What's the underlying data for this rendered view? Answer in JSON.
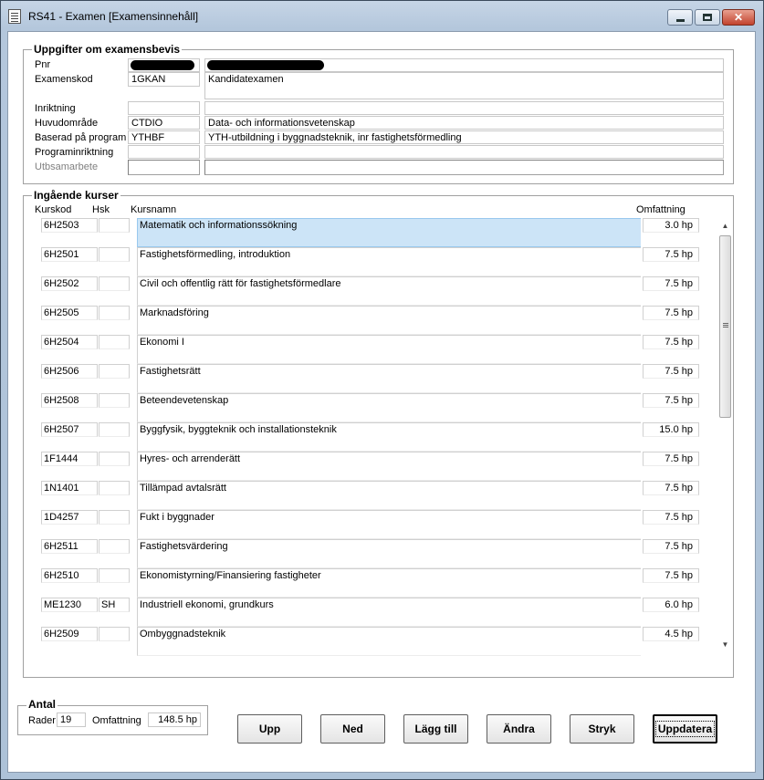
{
  "window": {
    "title": "RS41 - Examen [Examensinnehåll]",
    "close_glyph": "✕"
  },
  "examensbevis": {
    "legend": "Uppgifter om examensbevis",
    "pnr_label": "Pnr",
    "examenskod_label": "Examenskod",
    "examenskod_value": "1GKAN",
    "examen_name": "Kandidatexamen",
    "inriktning_label": "Inriktning",
    "huvudomrade_label": "Huvudområde",
    "huvudomrade_code": "CTDIO",
    "huvudomrade_name": "Data- och informationsvetenskap",
    "program_label": "Baserad på program",
    "program_code": "YTHBF",
    "program_name": "YTH-utbildning i byggnadsteknik, inr fastighetsförmedling",
    "programinriktning_label": "Programinriktning",
    "utbsamarbete_label": "Utbsamarbete"
  },
  "kurser": {
    "legend": "Ingående kurser",
    "headers": {
      "kod": "Kurskod",
      "hsk": "Hsk",
      "namn": "Kursnamn",
      "omf": "Omfattning"
    },
    "rows": [
      {
        "kod": "6H2503",
        "hsk": "",
        "namn": "Matematik och informationssökning",
        "omf": "3.0 hp"
      },
      {
        "kod": "6H2501",
        "hsk": "",
        "namn": "Fastighetsförmedling, introduktion",
        "omf": "7.5 hp"
      },
      {
        "kod": "6H2502",
        "hsk": "",
        "namn": "Civil och offentlig rätt för fastighetsförmedlare",
        "omf": "7.5 hp"
      },
      {
        "kod": "6H2505",
        "hsk": "",
        "namn": "Marknadsföring",
        "omf": "7.5 hp"
      },
      {
        "kod": "6H2504",
        "hsk": "",
        "namn": "Ekonomi I",
        "omf": "7.5 hp"
      },
      {
        "kod": "6H2506",
        "hsk": "",
        "namn": "Fastighetsrätt",
        "omf": "7.5 hp"
      },
      {
        "kod": "6H2508",
        "hsk": "",
        "namn": "Beteendevetenskap",
        "omf": "7.5 hp"
      },
      {
        "kod": "6H2507",
        "hsk": "",
        "namn": "Byggfysik, byggteknik och installationsteknik",
        "omf": "15.0 hp"
      },
      {
        "kod": "1F1444",
        "hsk": "",
        "namn": "Hyres- och arrenderätt",
        "omf": "7.5 hp"
      },
      {
        "kod": "1N1401",
        "hsk": "",
        "namn": "Tillämpad avtalsrätt",
        "omf": "7.5 hp"
      },
      {
        "kod": "1D4257",
        "hsk": "",
        "namn": "Fukt i byggnader",
        "omf": "7.5 hp"
      },
      {
        "kod": "6H2511",
        "hsk": "",
        "namn": "Fastighetsvärdering",
        "omf": "7.5 hp"
      },
      {
        "kod": "6H2510",
        "hsk": "",
        "namn": "Ekonomistyrning/Finansiering fastigheter",
        "omf": "7.5 hp"
      },
      {
        "kod": "ME1230",
        "hsk": "SH",
        "namn": "Industriell ekonomi, grundkurs",
        "omf": "6.0 hp"
      },
      {
        "kod": "6H2509",
        "hsk": "",
        "namn": "Ombyggnadsteknik",
        "omf": "4.5 hp"
      }
    ],
    "scroll_up": "▲",
    "scroll_down": "▼"
  },
  "antal": {
    "legend": "Antal",
    "rader_label": "Rader",
    "rader_value": "19",
    "omfattning_label": "Omfattning",
    "omfattning_value": "148.5 hp"
  },
  "buttons": {
    "upp": "Upp",
    "ned": "Ned",
    "lagg_till": "Lägg till",
    "andra": "Ändra",
    "stryk": "Stryk",
    "uppdatera": "Uppdatera"
  }
}
